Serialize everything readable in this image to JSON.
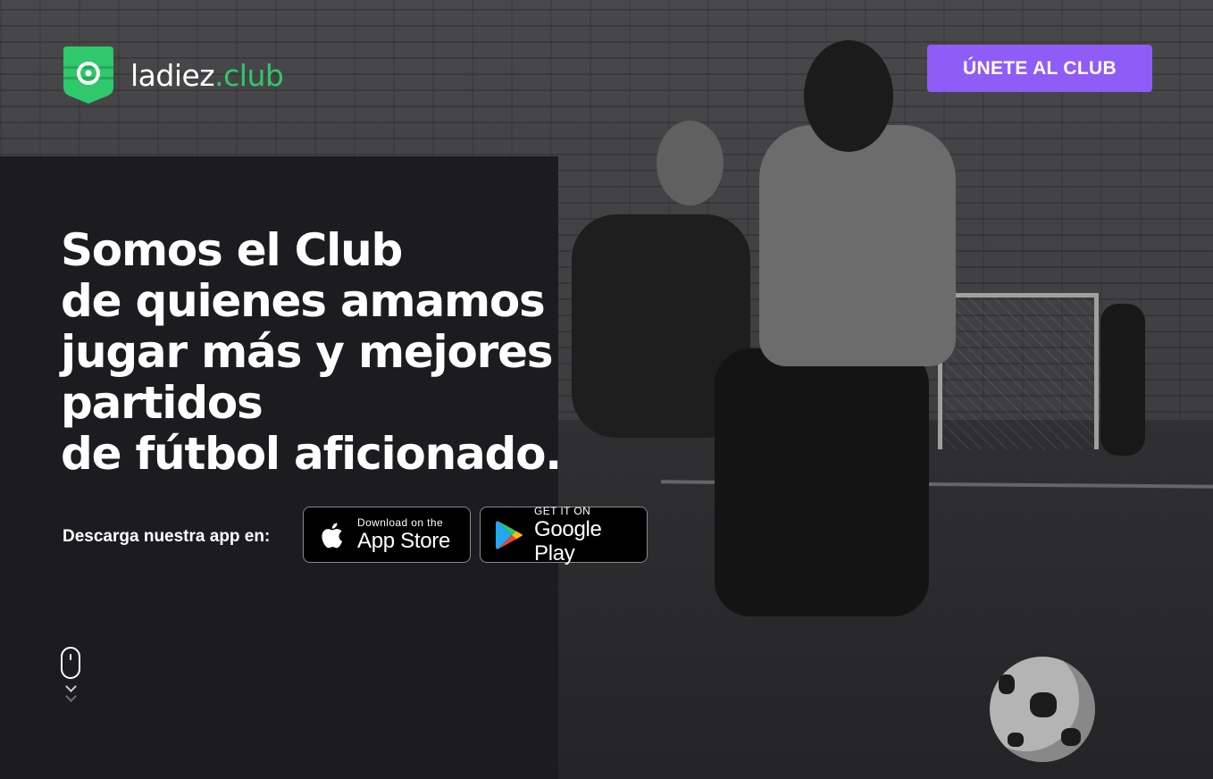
{
  "header": {
    "logo_name": "ladiez",
    "logo_suffix": ".club",
    "logo_icon": "shield-ball-icon",
    "join_button": "ÚNETE AL CLUB"
  },
  "hero": {
    "headline_lines": [
      "Somos el Club",
      "de quienes amamos",
      "jugar más y mejores",
      "partidos",
      "de fútbol aficionado."
    ],
    "download_label": "Descarga nuestra app en:",
    "app_store": {
      "small": "Download on the",
      "big": "App Store",
      "icon": "apple-icon"
    },
    "google_play": {
      "small": "GET IT ON",
      "big": "Google Play",
      "icon": "google-play-icon"
    },
    "scroll_icon": "mouse-scroll-icon"
  },
  "colors": {
    "accent_green": "#2fc86b",
    "button_purple": "#8f5cf7",
    "panel_dark": "#1c1b20"
  }
}
